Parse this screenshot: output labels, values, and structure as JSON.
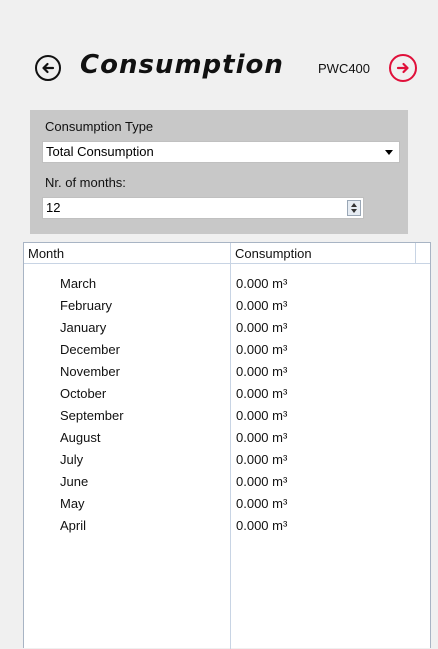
{
  "header": {
    "title": "Consumption",
    "device": "PWC400"
  },
  "filters": {
    "type_label": "Consumption Type",
    "type_value": "Total Consumption",
    "months_label": "Nr. of months:",
    "months_value": "12"
  },
  "table": {
    "columns": [
      "Month",
      "Consumption"
    ],
    "rows": [
      {
        "month": "March",
        "value": "0.000 m³"
      },
      {
        "month": "February",
        "value": "0.000 m³"
      },
      {
        "month": "January",
        "value": "0.000 m³"
      },
      {
        "month": "December",
        "value": "0.000 m³"
      },
      {
        "month": "November",
        "value": "0.000 m³"
      },
      {
        "month": "October",
        "value": "0.000 m³"
      },
      {
        "month": "September",
        "value": "0.000 m³"
      },
      {
        "month": "August",
        "value": "0.000 m³"
      },
      {
        "month": "July",
        "value": "0.000 m³"
      },
      {
        "month": "June",
        "value": "0.000 m³"
      },
      {
        "month": "May",
        "value": "0.000 m³"
      },
      {
        "month": "April",
        "value": "0.000 m³"
      }
    ]
  },
  "colors": {
    "accent": "#e0103a",
    "panel": "#c8c8c8"
  }
}
